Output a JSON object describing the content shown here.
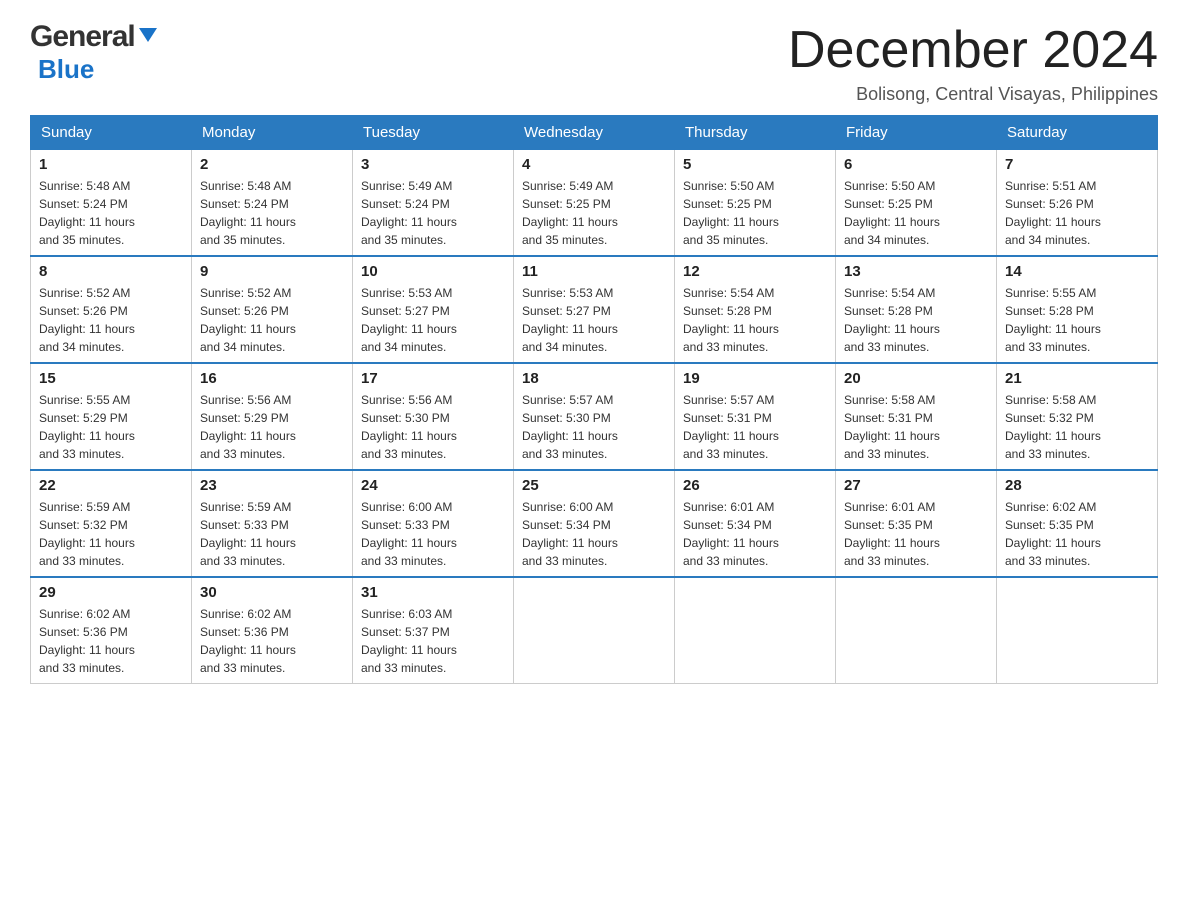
{
  "header": {
    "logo_general": "General",
    "logo_blue": "Blue",
    "month_title": "December 2024",
    "subtitle": "Bolisong, Central Visayas, Philippines"
  },
  "weekdays": [
    "Sunday",
    "Monday",
    "Tuesday",
    "Wednesday",
    "Thursday",
    "Friday",
    "Saturday"
  ],
  "weeks": [
    [
      {
        "day": "1",
        "sunrise": "5:48 AM",
        "sunset": "5:24 PM",
        "daylight": "11 hours and 35 minutes."
      },
      {
        "day": "2",
        "sunrise": "5:48 AM",
        "sunset": "5:24 PM",
        "daylight": "11 hours and 35 minutes."
      },
      {
        "day": "3",
        "sunrise": "5:49 AM",
        "sunset": "5:24 PM",
        "daylight": "11 hours and 35 minutes."
      },
      {
        "day": "4",
        "sunrise": "5:49 AM",
        "sunset": "5:25 PM",
        "daylight": "11 hours and 35 minutes."
      },
      {
        "day": "5",
        "sunrise": "5:50 AM",
        "sunset": "5:25 PM",
        "daylight": "11 hours and 35 minutes."
      },
      {
        "day": "6",
        "sunrise": "5:50 AM",
        "sunset": "5:25 PM",
        "daylight": "11 hours and 34 minutes."
      },
      {
        "day": "7",
        "sunrise": "5:51 AM",
        "sunset": "5:26 PM",
        "daylight": "11 hours and 34 minutes."
      }
    ],
    [
      {
        "day": "8",
        "sunrise": "5:52 AM",
        "sunset": "5:26 PM",
        "daylight": "11 hours and 34 minutes."
      },
      {
        "day": "9",
        "sunrise": "5:52 AM",
        "sunset": "5:26 PM",
        "daylight": "11 hours and 34 minutes."
      },
      {
        "day": "10",
        "sunrise": "5:53 AM",
        "sunset": "5:27 PM",
        "daylight": "11 hours and 34 minutes."
      },
      {
        "day": "11",
        "sunrise": "5:53 AM",
        "sunset": "5:27 PM",
        "daylight": "11 hours and 34 minutes."
      },
      {
        "day": "12",
        "sunrise": "5:54 AM",
        "sunset": "5:28 PM",
        "daylight": "11 hours and 33 minutes."
      },
      {
        "day": "13",
        "sunrise": "5:54 AM",
        "sunset": "5:28 PM",
        "daylight": "11 hours and 33 minutes."
      },
      {
        "day": "14",
        "sunrise": "5:55 AM",
        "sunset": "5:28 PM",
        "daylight": "11 hours and 33 minutes."
      }
    ],
    [
      {
        "day": "15",
        "sunrise": "5:55 AM",
        "sunset": "5:29 PM",
        "daylight": "11 hours and 33 minutes."
      },
      {
        "day": "16",
        "sunrise": "5:56 AM",
        "sunset": "5:29 PM",
        "daylight": "11 hours and 33 minutes."
      },
      {
        "day": "17",
        "sunrise": "5:56 AM",
        "sunset": "5:30 PM",
        "daylight": "11 hours and 33 minutes."
      },
      {
        "day": "18",
        "sunrise": "5:57 AM",
        "sunset": "5:30 PM",
        "daylight": "11 hours and 33 minutes."
      },
      {
        "day": "19",
        "sunrise": "5:57 AM",
        "sunset": "5:31 PM",
        "daylight": "11 hours and 33 minutes."
      },
      {
        "day": "20",
        "sunrise": "5:58 AM",
        "sunset": "5:31 PM",
        "daylight": "11 hours and 33 minutes."
      },
      {
        "day": "21",
        "sunrise": "5:58 AM",
        "sunset": "5:32 PM",
        "daylight": "11 hours and 33 minutes."
      }
    ],
    [
      {
        "day": "22",
        "sunrise": "5:59 AM",
        "sunset": "5:32 PM",
        "daylight": "11 hours and 33 minutes."
      },
      {
        "day": "23",
        "sunrise": "5:59 AM",
        "sunset": "5:33 PM",
        "daylight": "11 hours and 33 minutes."
      },
      {
        "day": "24",
        "sunrise": "6:00 AM",
        "sunset": "5:33 PM",
        "daylight": "11 hours and 33 minutes."
      },
      {
        "day": "25",
        "sunrise": "6:00 AM",
        "sunset": "5:34 PM",
        "daylight": "11 hours and 33 minutes."
      },
      {
        "day": "26",
        "sunrise": "6:01 AM",
        "sunset": "5:34 PM",
        "daylight": "11 hours and 33 minutes."
      },
      {
        "day": "27",
        "sunrise": "6:01 AM",
        "sunset": "5:35 PM",
        "daylight": "11 hours and 33 minutes."
      },
      {
        "day": "28",
        "sunrise": "6:02 AM",
        "sunset": "5:35 PM",
        "daylight": "11 hours and 33 minutes."
      }
    ],
    [
      {
        "day": "29",
        "sunrise": "6:02 AM",
        "sunset": "5:36 PM",
        "daylight": "11 hours and 33 minutes."
      },
      {
        "day": "30",
        "sunrise": "6:02 AM",
        "sunset": "5:36 PM",
        "daylight": "11 hours and 33 minutes."
      },
      {
        "day": "31",
        "sunrise": "6:03 AM",
        "sunset": "5:37 PM",
        "daylight": "11 hours and 33 minutes."
      },
      null,
      null,
      null,
      null
    ]
  ],
  "labels": {
    "sunrise": "Sunrise:",
    "sunset": "Sunset:",
    "daylight": "Daylight:"
  }
}
